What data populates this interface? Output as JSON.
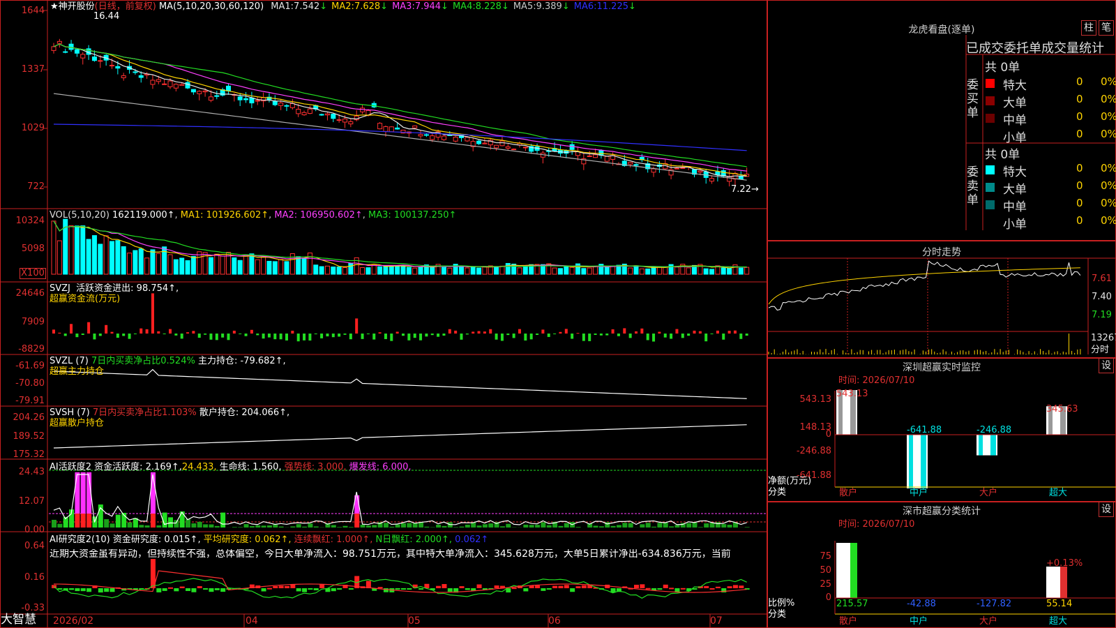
{
  "app": {
    "brand": "大智慧",
    "date_start": "2026/02",
    "months": [
      "04",
      "05",
      "06",
      "07"
    ]
  },
  "main": {
    "stock": "神开股份",
    "period": "(日线，前复权)",
    "ma_params": "MA(5,10,20,30,60,120)",
    "ma": [
      {
        "label": "MA1:",
        "value": "7.542",
        "dir": "↓",
        "color": "#e6e6e6"
      },
      {
        "label": "MA2:",
        "value": "7.628",
        "dir": "↓",
        "color": "#ffd400"
      },
      {
        "label": "MA3:",
        "value": "7.944",
        "dir": "↓",
        "color": "#ff40ff"
      },
      {
        "label": "MA4:",
        "value": "8.228",
        "dir": "↓",
        "color": "#22dd22"
      },
      {
        "label": "MA5:",
        "value": "9.389",
        "dir": "↓",
        "color": "#c8c8c8"
      },
      {
        "label": "MA6:",
        "value": "11.225",
        "dir": "↓",
        "color": "#3030ff"
      }
    ],
    "high_label": "16.44",
    "low_label": "7.22→",
    "yticks": [
      "1644",
      "1337",
      "1029",
      "722"
    ]
  },
  "vol": {
    "title": "VOL(5,10,20)",
    "value": "162119.000↑",
    "ma1": "MA1: 101926.602↑",
    "ma2": "MA2: 106950.602↑",
    "ma3": "MA3: 100137.250↑",
    "yticks": [
      "10324",
      "5098",
      "X100"
    ]
  },
  "svzj": {
    "title": "SVZJ",
    "line1": "活跃资金进出: 98.754↑,",
    "line2": "超赢资金流(万元)",
    "yticks": [
      "24646",
      "7909",
      "-8829"
    ]
  },
  "svzl": {
    "title": "SVZL (7)",
    "pct": "7日内买卖净占比0.524%",
    "hold": "主力持仓: -79.682↑,",
    "line2": "超赢主力持仓",
    "yticks": [
      "-61.69",
      "-70.80",
      "-79.91"
    ]
  },
  "svsh": {
    "title": "SVSH (7)",
    "pct": "7日内买卖净占比1.103%",
    "hold": "散户持仓: 204.066↑,",
    "line2": "超赢散户持仓",
    "yticks": [
      "204.26",
      "189.52",
      "175.32"
    ]
  },
  "ai1": {
    "title": "AI活跃度2",
    "t1": "资金活跃度: 2.169↑,",
    "t2": "24.433,",
    "t3": "生命线: 1.560,",
    "t4": "强势线: 3.000,",
    "t5": "爆发线: 6.000,",
    "yticks": [
      "24.43",
      "12.07",
      "0.00"
    ]
  },
  "ai2": {
    "title": "AI研究度2(10)",
    "t1": "资金研究度: 0.015↑,",
    "t2": "平均研究度: 0.062↑,",
    "t3": "连续飘红: 1.000↑,",
    "t4": "N日飘红: 2.000↑,",
    "t5": "0.062↑",
    "comment": "近期大资金虽有异动，但持续性不强，总体偏空，今日大单净流入：98.751万元，其中特大单净流入：345.628万元，大单5日累计净出-634.836万元，当前",
    "yticks": [
      "0.64",
      "0.16",
      "-0.33"
    ]
  },
  "lhb": {
    "title": "龙虎看盘(逐单)",
    "btn1": "柱",
    "btn2": "笔",
    "subtitle": "已成交委托单成交量统计",
    "buy_total": "共 0单",
    "sell_total": "共 0单",
    "buy_label": "委买单",
    "sell_label": "委卖单",
    "buy_rows": [
      {
        "name": "特大",
        "v": "0",
        "p": "0%",
        "c": "#ff0000"
      },
      {
        "name": "大单",
        "v": "0",
        "p": "0%",
        "c": "#8b0000"
      },
      {
        "name": "中单",
        "v": "0",
        "p": "0%",
        "c": "#6b0000"
      },
      {
        "name": "小单",
        "v": "0",
        "p": "0%",
        "c": ""
      }
    ],
    "sell_rows": [
      {
        "name": "特大",
        "v": "0",
        "p": "0%",
        "c": "#00ffff"
      },
      {
        "name": "大单",
        "v": "0",
        "p": "0%",
        "c": "#008b8b"
      },
      {
        "name": "中单",
        "v": "0",
        "p": "0%",
        "c": "#006b6b"
      },
      {
        "name": "小单",
        "v": "0",
        "p": "0%",
        "c": ""
      }
    ]
  },
  "fenshi": {
    "title": "分时走势",
    "prices": [
      "7.61",
      "7.40",
      "7.19"
    ],
    "vol": "13267",
    "vol_unit": "分时"
  },
  "monitor": {
    "title": "深圳超赢实时监控",
    "btn": "设",
    "time": "时间: 2026/07/10",
    "yticks": [
      "543.13",
      "148.13",
      "0",
      "-246.88",
      "-641.88"
    ],
    "ylabel": "净额(万元)",
    "xlabel": "分类",
    "cats": [
      "散户",
      "中户",
      "大户",
      "超大"
    ],
    "values": [
      543.13,
      -641.88,
      -246.88,
      345.63
    ],
    "vlabels": [
      "543.13",
      "-641.88",
      "-246.88",
      "345.63"
    ]
  },
  "classify": {
    "title": "深市超赢分类统计",
    "btn": "设",
    "time": "时间: 2026/07/10",
    "yticks": [
      "75",
      "50",
      "25",
      "0"
    ],
    "ylabel": "比例%",
    "xlabel": "分类",
    "cats": [
      "散户",
      "中户",
      "大户",
      "超大"
    ],
    "vlabels": [
      "215.57",
      "-42.88",
      "-127.82",
      "55.14"
    ],
    "top_label": "+0.13%"
  }
}
